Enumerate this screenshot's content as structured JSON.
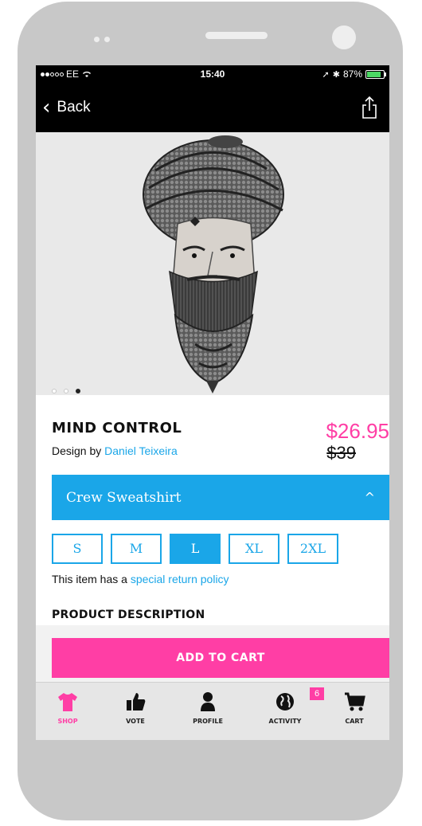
{
  "status_bar": {
    "carrier": "EE",
    "time": "15:40",
    "battery": "87%"
  },
  "nav": {
    "back_label": "Back"
  },
  "product": {
    "title": "MIND CONTROL",
    "byline_prefix": "Design by",
    "designer": "Daniel Teixeira",
    "price": "$26.95",
    "original_price": "$39",
    "image_pages": 3,
    "current_image_page": 3
  },
  "style_select": {
    "selected": "Crew Sweatshirt"
  },
  "sizes": [
    {
      "label": "S"
    },
    {
      "label": "M"
    },
    {
      "label": "L"
    },
    {
      "label": "XL"
    },
    {
      "label": "2XL"
    }
  ],
  "selected_size": "L",
  "policy": {
    "prefix": "This item has a",
    "link": "special return policy"
  },
  "description": {
    "heading": "PRODUCT DESCRIPTION"
  },
  "add_to_cart_label": "ADD TO CART",
  "tabbar": {
    "items": [
      {
        "label": "SHOP",
        "icon": "tshirt-icon",
        "active": true
      },
      {
        "label": "VOTE",
        "icon": "thumbs-up-icon",
        "active": false
      },
      {
        "label": "PROFILE",
        "icon": "person-icon",
        "active": false
      },
      {
        "label": "ACTIVITY",
        "icon": "globe-icon",
        "active": false,
        "badge": "6"
      },
      {
        "label": "CART",
        "icon": "cart-icon",
        "active": false
      }
    ]
  },
  "colors": {
    "accent_blue": "#1aa6e8",
    "accent_pink": "#ff3ea5",
    "bar_black": "#000000"
  }
}
